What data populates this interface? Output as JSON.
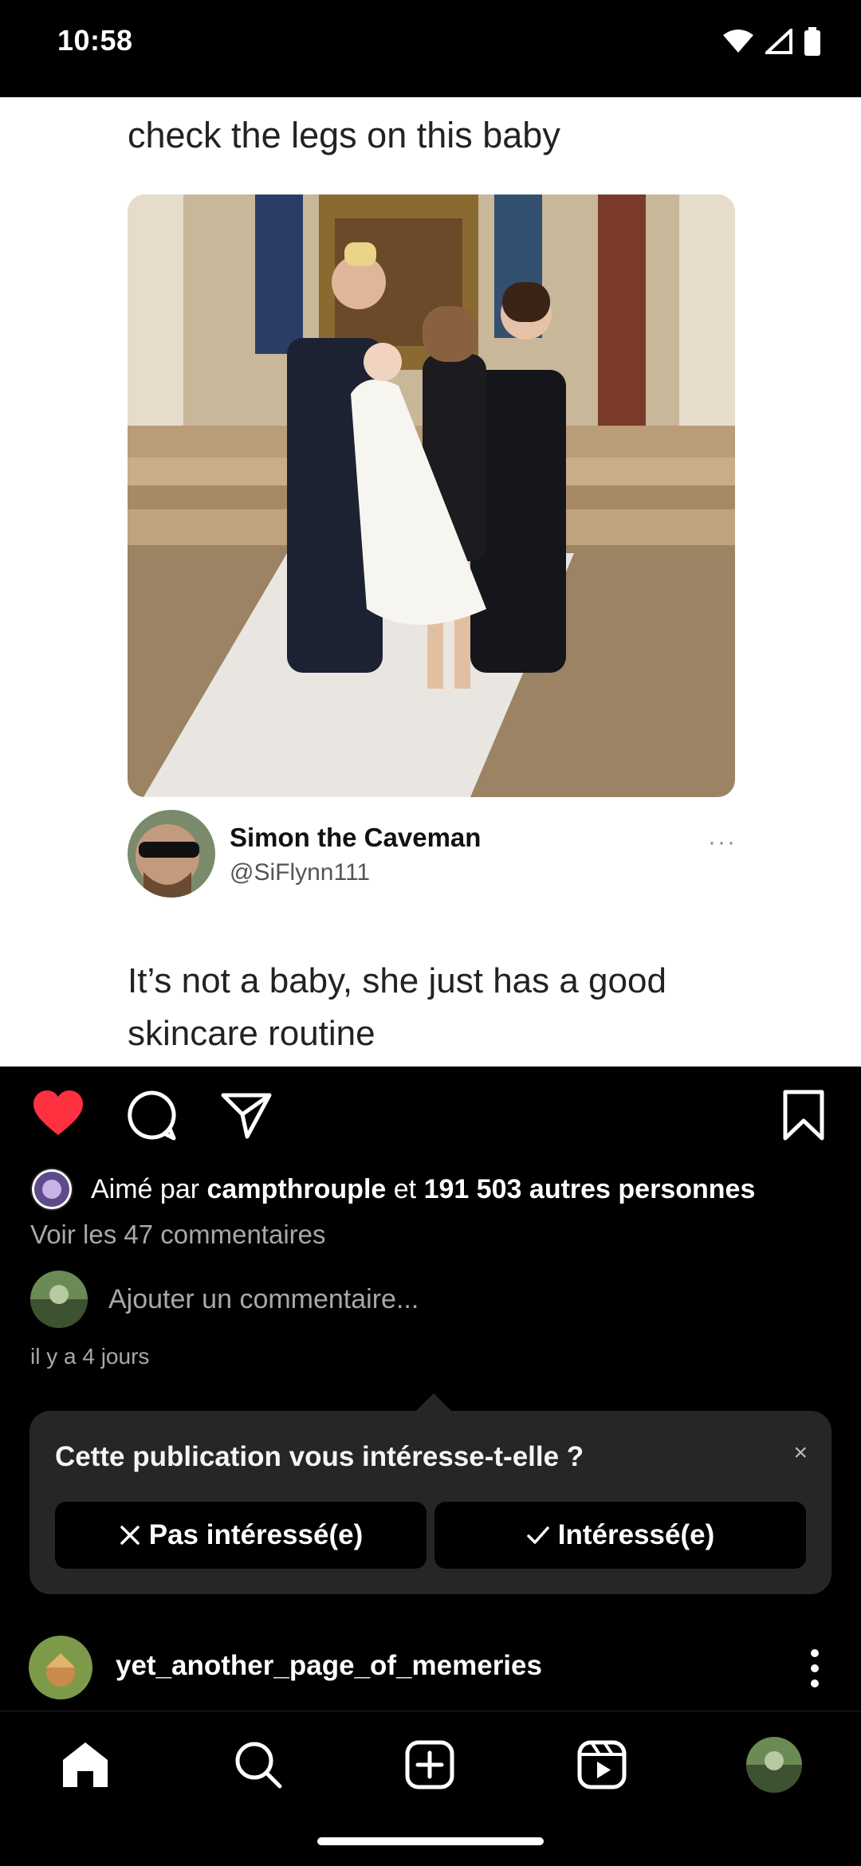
{
  "status_bar": {
    "time": "10:58"
  },
  "post": {
    "meme_caption": "check the legs on this baby",
    "tweet": {
      "display_name": "Simon the Caveman",
      "handle": "@SiFlynn111",
      "more": "···",
      "text": "It’s not a baby, she just has a good skincare routine"
    },
    "likes": {
      "prefix": "Aimé par ",
      "user": "campthrouple",
      "middle": " et ",
      "others": "191 503 autres personnes"
    },
    "view_comments": "Voir les 47 commentaires",
    "comment_placeholder": "Ajouter un commentaire...",
    "time_ago": "il y a 4 jours"
  },
  "interest_card": {
    "question": "Cette publication vous intéresse-t-elle ?",
    "close": "×",
    "not_interested": "Pas intéressé(e)",
    "interested": "Intéressé(e)"
  },
  "next_post": {
    "username": "yet_another_page_of_memeries"
  },
  "colors": {
    "like_red": "#ff3040",
    "card_bg": "#262626",
    "muted": "#a8a8a8"
  }
}
